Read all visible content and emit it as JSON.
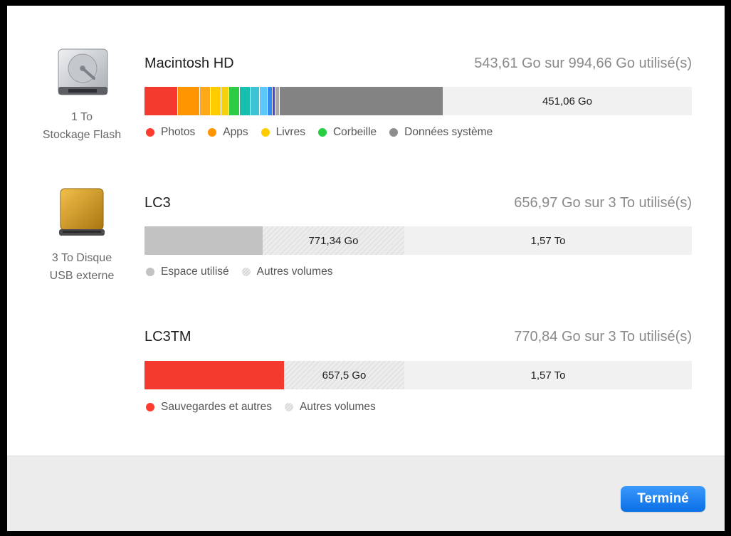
{
  "devices": [
    {
      "icon": "internal-drive-icon",
      "caption_line1": "1 To",
      "caption_line2": "Stockage Flash"
    },
    {
      "icon": "external-usb-drive-icon",
      "caption_line1": "3 To Disque",
      "caption_line2": "USB externe"
    }
  ],
  "volumes": [
    {
      "name": "Macintosh HD",
      "usage": "543,61 Go sur 994,66 Go utilisé(s)",
      "free_label": "451,06 Go",
      "legend": [
        {
          "label": "Photos",
          "color": "#ff3b30"
        },
        {
          "label": "Apps",
          "color": "#ff9500"
        },
        {
          "label": "Livres",
          "color": "#ffcc00"
        },
        {
          "label": "Corbeille",
          "color": "#28cd41"
        },
        {
          "label": "Données système",
          "color": "#8e8e8e"
        }
      ]
    },
    {
      "name": "LC3",
      "usage": "656,97 Go sur 3 To utilisé(s)",
      "other_label": "771,34 Go",
      "free_label": "1,57 To",
      "legend": [
        {
          "label": "Espace utilisé",
          "color": "#c2c2c2"
        },
        {
          "label": "Autres volumes",
          "color": "hatch"
        }
      ]
    },
    {
      "name": "LC3TM",
      "usage": "770,84 Go sur 3 To utilisé(s)",
      "other_label": "657,5 Go",
      "free_label": "1,57 To",
      "legend": [
        {
          "label": "Sauvegardes et autres",
          "color": "#ff3b30"
        },
        {
          "label": "Autres volumes",
          "color": "hatch"
        }
      ]
    }
  ],
  "footer": {
    "done_label": "Terminé"
  },
  "colors": {
    "accent": "#1a7ef2",
    "used_gray": "#c2c2c2",
    "system_gray": "#838383",
    "free": "#f1f1f1"
  }
}
